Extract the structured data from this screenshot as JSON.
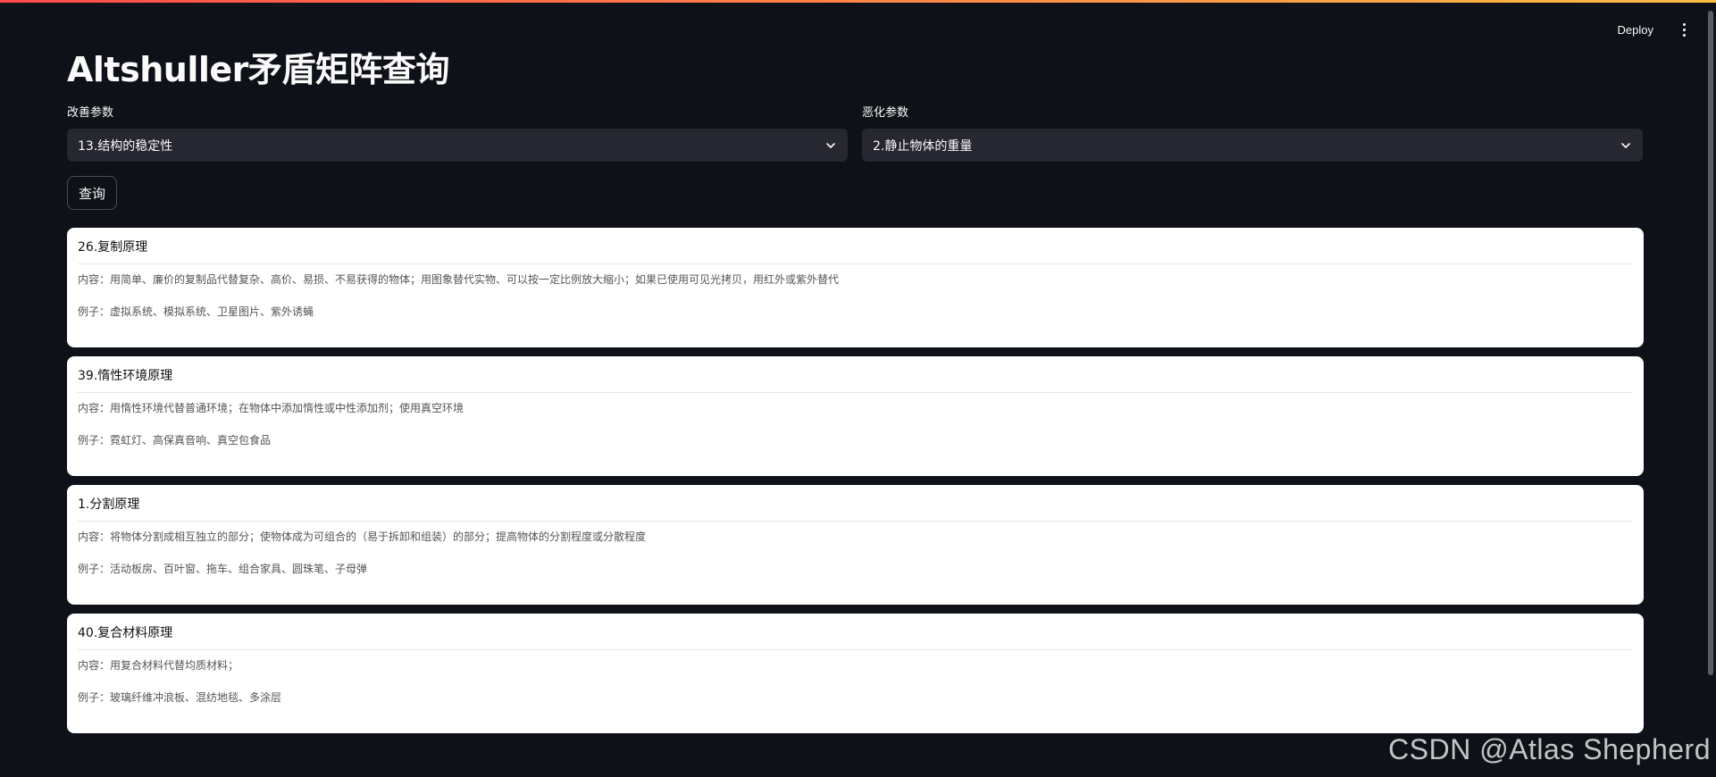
{
  "header": {
    "deploy_label": "Deploy",
    "menu_icon": "kebab-menu-icon"
  },
  "main": {
    "title": "Altshuller矛盾矩阵查询",
    "improve": {
      "label": "改善参数",
      "value": "13.结构的稳定性"
    },
    "worsen": {
      "label": "恶化参数",
      "value": "2.静止物体的重量"
    },
    "query_label": "查询"
  },
  "results": [
    {
      "title": "26.复制原理",
      "content": "内容：用简单、廉价的复制品代替复杂、高价、易损、不易获得的物体；用图象替代实物、可以按一定比例放大缩小；如果已使用可见光拷贝，用红外或紫外替代",
      "example": "例子：虚拟系统、模拟系统、卫星图片、紫外诱蝇"
    },
    {
      "title": "39.惰性环境原理",
      "content": "内容：用惰性环境代替普通环境；在物体中添加惰性或中性添加剂；使用真空环境",
      "example": "例子：霓虹灯、高保真音响、真空包食品"
    },
    {
      "title": "1.分割原理",
      "content": "内容：将物体分割成相互独立的部分；使物体成为可组合的（易于拆卸和组装）的部分；提高物体的分割程度或分散程度",
      "example": "例子：活动板房、百叶窗、拖车、组合家具、圆珠笔、子母弹"
    },
    {
      "title": "40.复合材料原理",
      "content": "内容：用复合材料代替均质材料；",
      "example": "例子：玻璃纤维冲浪板、混纺地毯、多涂层"
    }
  ],
  "watermark": "CSDN @Atlas Shepherd",
  "colors": {
    "background": "#0e1117",
    "select_bg": "#262730",
    "card_bg": "#ffffff",
    "accent_gradient_start": "#ff4b4b",
    "accent_gradient_end": "#ffbd45"
  }
}
